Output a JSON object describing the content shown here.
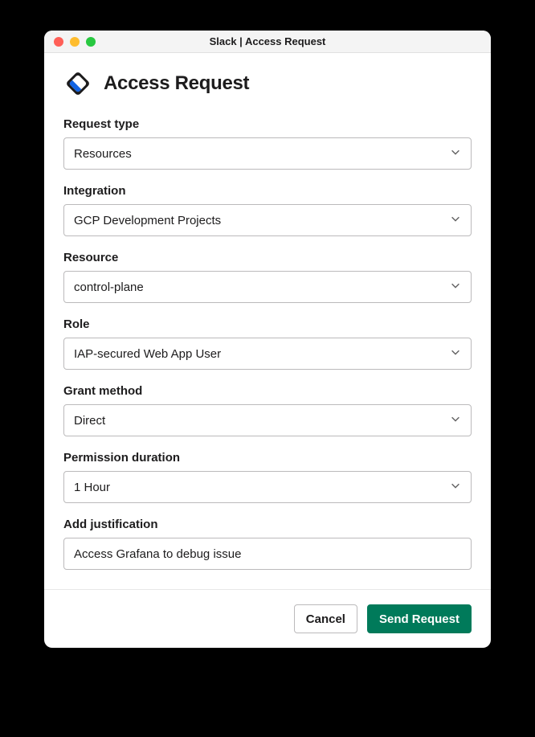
{
  "window": {
    "title": "Slack | Access Request"
  },
  "header": {
    "title": "Access Request"
  },
  "fields": {
    "request_type": {
      "label": "Request type",
      "value": "Resources"
    },
    "integration": {
      "label": "Integration",
      "value": "GCP Development Projects"
    },
    "resource": {
      "label": "Resource",
      "value": "control-plane"
    },
    "role": {
      "label": "Role",
      "value": "IAP-secured Web App User"
    },
    "grant_method": {
      "label": "Grant method",
      "value": "Direct"
    },
    "permission_duration": {
      "label": "Permission duration",
      "value": "1 Hour"
    },
    "justification": {
      "label": "Add justification",
      "value": "Access Grafana to debug issue"
    }
  },
  "footer": {
    "cancel": "Cancel",
    "submit": "Send Request"
  }
}
